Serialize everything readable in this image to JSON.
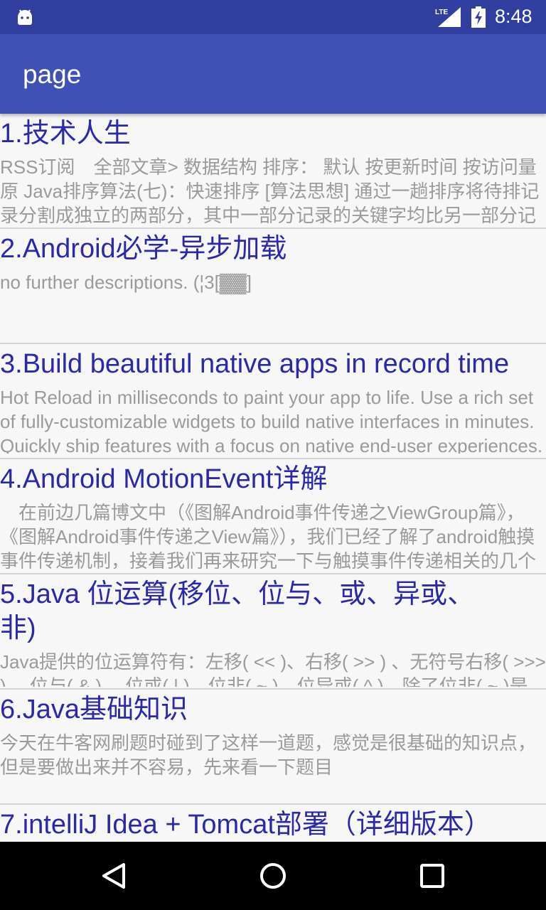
{
  "status_bar": {
    "time": "8:48",
    "network": "LTE",
    "icons": [
      "android-icon",
      "signal-icon",
      "battery-charging-icon"
    ]
  },
  "app_bar": {
    "title": "page"
  },
  "articles": [
    {
      "title": "1.技术人生",
      "description": "RSS订阅　全部文章> 数据结构 排序： 默认 按更新时间 按访问量　 原 Java排序算法(七)：快速排序 [算法思想] 通过一趟排序将待排记录分割成独立的两部分，其中一部分记录的关键字均比另一部分记录的关键字小"
    },
    {
      "title": "2.Android必学-异步加载",
      "description": "no further descriptions. (¦3[▓▓]"
    },
    {
      "title": "3.Build beautiful native apps in record time",
      "description": "Hot Reload in milliseconds to paint your app to life. Use a rich set of fully-customizable widgets to build native interfaces in minutes.  Quickly ship features with a focus on native end-user experiences."
    },
    {
      "title": "4.Android MotionEvent详解",
      "description": "　在前边几篇博文中（《图解Android事件传递之ViewGroup篇》，《图解Android事件传递之View篇》），我们已经了解了android触摸事件传递机制，接着我们再来研究一下与触摸事件传递相关的几个比较重要的类，比如MotionEvent。我们今天就对"
    },
    {
      "title": "5.Java 位运算(移位、位与、或、异或、非)",
      "description": "Java提供的位运算符有：左移( << )、右移( >> ) 、无符号右移( >>> ) 、位与( & ) 、位或( | )、位非( ~ )、位异或( ^ )，除了位非( ~ )是一元操作符外，其它的都是二元操作符。"
    },
    {
      "title": "6.Java基础知识",
      "description": "今天在牛客网刷题时碰到了这样一道题，感觉是很基础的知识点，但是要做出来并不容易，先来看一下题目"
    },
    {
      "title": "7.intelliJ Idea + Tomcat部署（详细版本）",
      "description": ""
    }
  ],
  "nav_bar": {
    "buttons": [
      "back-icon",
      "home-icon",
      "recents-icon"
    ]
  }
}
